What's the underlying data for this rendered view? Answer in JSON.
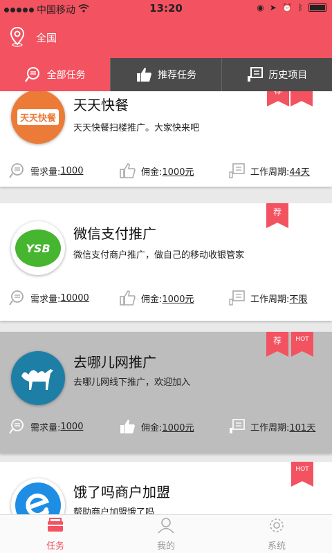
{
  "status": {
    "carrier": "中国移动",
    "time": "13:20"
  },
  "header": {
    "location": "全国"
  },
  "tabs": [
    {
      "label": "全部任务",
      "icon": "search-list-icon",
      "active": true
    },
    {
      "label": "推荐任务",
      "icon": "thumbs-up-icon",
      "active": false
    },
    {
      "label": "历史项目",
      "icon": "history-icon",
      "active": false
    }
  ],
  "stat_labels": {
    "demand": "需求量:",
    "commission": "佣金:",
    "period": "工作周期:"
  },
  "tasks": [
    {
      "title": "天天快餐",
      "desc": "天天快餐扫楼推广。大家快来吧",
      "logo_text": "天天快餐",
      "demand": "1000",
      "commission": "1000元",
      "period": "44天",
      "badges": [
        "荐"
      ]
    },
    {
      "title": "微信支付推广",
      "desc": "微信支付商户推广，做自己的移动收银管家",
      "logo_text": "YSB",
      "demand": "10000",
      "commission": "1000元",
      "period": "不限",
      "badges": [
        "荐"
      ]
    },
    {
      "title": "去哪儿网推广",
      "desc": "去哪儿网线下推广，欢迎加入",
      "logo_text": "",
      "demand": "1000",
      "commission": "1000元",
      "period": "101天",
      "badges": [
        "荐",
        "HOT"
      ]
    },
    {
      "title": "饿了吗商户加盟",
      "desc": "帮助商户加盟饿了吗",
      "logo_text": "",
      "badges": [
        "HOT"
      ]
    }
  ],
  "bottom_nav": [
    {
      "label": "任务",
      "icon": "task-card-icon",
      "active": true
    },
    {
      "label": "我的",
      "icon": "person-icon",
      "active": false
    },
    {
      "label": "系统",
      "icon": "gear-icon",
      "active": false
    }
  ],
  "colors": {
    "accent": "#f35260",
    "tab_bar": "#4b4b4b"
  }
}
